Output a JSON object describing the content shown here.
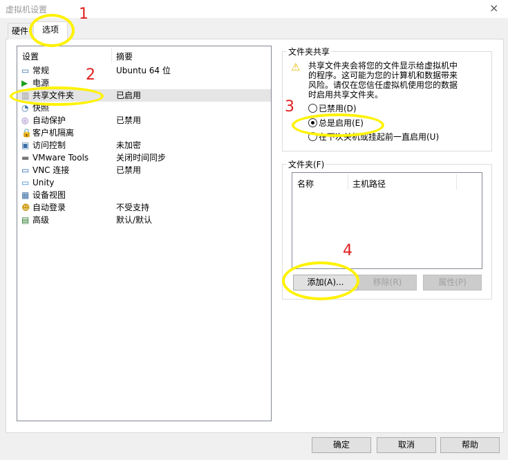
{
  "window": {
    "title": "虚拟机设置",
    "close": "×"
  },
  "tabs": [
    {
      "label": "硬件",
      "selected": false
    },
    {
      "label": "选项",
      "selected": true
    }
  ],
  "settings": {
    "header_setting": "设置",
    "header_summary": "摘要",
    "items": [
      {
        "name": "常规",
        "summary": "Ubuntu 64 位",
        "icon": "monitor-icon"
      },
      {
        "name": "电源",
        "summary": "",
        "icon": "play-icon"
      },
      {
        "name": "共享文件夹",
        "summary": "已启用",
        "icon": "shared-folder-icon",
        "selected": true
      },
      {
        "name": "快照",
        "summary": "",
        "icon": "snapshot-icon"
      },
      {
        "name": "自动保护",
        "summary": "已禁用",
        "icon": "autoprotect-icon"
      },
      {
        "name": "客户机隔离",
        "summary": "",
        "icon": "lock-icon"
      },
      {
        "name": "访问控制",
        "summary": "未加密",
        "icon": "access-control-icon"
      },
      {
        "name": "VMware Tools",
        "summary": "关闭时间同步",
        "icon": "vmware-tools-icon"
      },
      {
        "name": "VNC 连接",
        "summary": "已禁用",
        "icon": "vnc-icon"
      },
      {
        "name": "Unity",
        "summary": "",
        "icon": "unity-icon"
      },
      {
        "name": "设备视图",
        "summary": "",
        "icon": "device-view-icon"
      },
      {
        "name": "自动登录",
        "summary": "不受支持",
        "icon": "autologin-icon"
      },
      {
        "name": "高级",
        "summary": "默认/默认",
        "icon": "advanced-icon"
      }
    ]
  },
  "sharing": {
    "legend": "文件夹共享",
    "warning": [
      "共享文件夹会将您的文件显示给虚拟机中",
      "的程序。这可能为您的计算机和数据带来",
      "风险。请仅在您信任虚拟机使用您的数据",
      "时启用共享文件夹。"
    ],
    "options": [
      {
        "label": "已禁用(D)",
        "checked": false
      },
      {
        "label": "总是启用(E)",
        "checked": true
      },
      {
        "label": "在下次关机或挂起前一直启用(U)",
        "checked": false
      }
    ]
  },
  "folders": {
    "legend": "文件夹(F)",
    "col_name": "名称",
    "col_path": "主机路径",
    "add": "添加(A)...",
    "remove": "移除(R)",
    "properties": "属性(P)"
  },
  "footer": {
    "ok": "确定",
    "cancel": "取消",
    "help": "帮助"
  },
  "annotations": {
    "n1": "1",
    "n2": "2",
    "n3": "3",
    "n4": "4",
    "color": "#fff200",
    "number_color": "#e02020"
  }
}
